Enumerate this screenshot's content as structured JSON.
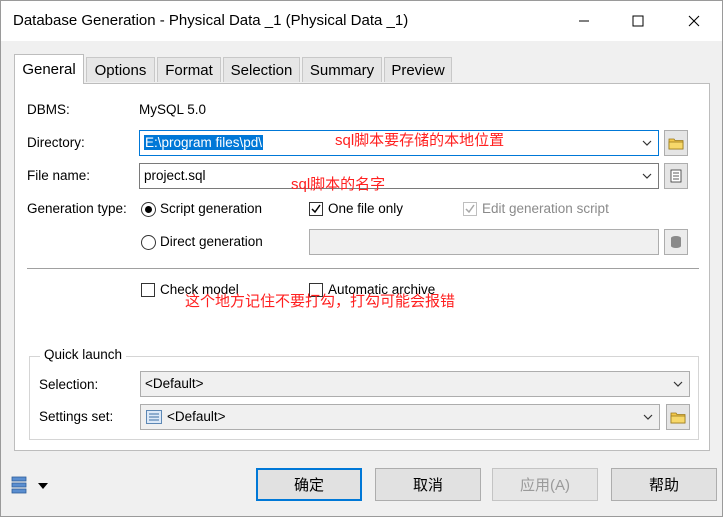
{
  "window": {
    "title": "Database Generation - Physical Data _1 (Physical Data _1)",
    "controls": {
      "minimize": "minimize-icon",
      "maximize": "maximize-icon",
      "close": "close-icon"
    }
  },
  "tabs": [
    {
      "label": "General",
      "active": true
    },
    {
      "label": "Options",
      "active": false
    },
    {
      "label": "Format",
      "active": false
    },
    {
      "label": "Selection",
      "active": false
    },
    {
      "label": "Summary",
      "active": false
    },
    {
      "label": "Preview",
      "active": false
    }
  ],
  "general": {
    "dbms_label": "DBMS:",
    "dbms_value": "MySQL 5.0",
    "directory_label": "Directory:",
    "directory_value": "E:\\program files\\pd\\",
    "directory_note": "sql脚本要存储的本地位置",
    "filename_label": "File name:",
    "filename_value": "project.sql",
    "filename_note": "sql脚本的名字",
    "generation_type_label": "Generation type:",
    "script_generation": "Script generation",
    "direct_generation": "Direct generation",
    "one_file_only": "One file only",
    "edit_generation_script": "Edit generation script",
    "check_model": "Check model",
    "automatic_archive": "Automatic archive",
    "check_note": "这个地方记住不要打勾，打勾可能会报错"
  },
  "quick_launch": {
    "title": "Quick launch",
    "selection_label": "Selection:",
    "selection_value": "<Default>",
    "settings_label": "Settings set:",
    "settings_value": "<Default>"
  },
  "buttons": {
    "ok": "确定",
    "cancel": "取消",
    "apply": "应用(A)",
    "help": "帮助"
  },
  "colors": {
    "accent": "#0078d7",
    "note": "#ff2020"
  }
}
